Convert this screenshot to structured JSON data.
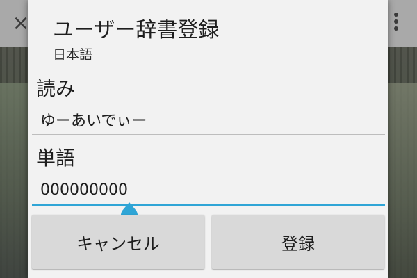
{
  "dialog": {
    "title": "ユーザー辞書登録",
    "subtitle": "日本語",
    "reading": {
      "label": "読み",
      "value": "ゆーあいでぃー"
    },
    "word": {
      "label": "単語",
      "value": "000000000"
    },
    "buttons": {
      "cancel_label": "キャンセル",
      "register_label": "登録"
    }
  },
  "background": {
    "close_glyph": "×"
  },
  "colors": {
    "accent": "#2fa5d6",
    "dialog_background": "#f2f2f2",
    "button_background": "#d9d9d9"
  },
  "icons": {
    "close": "close-icon",
    "overflow_menu": "more-vert-icon",
    "text_cursor_handle": "cursor-handle-icon"
  }
}
